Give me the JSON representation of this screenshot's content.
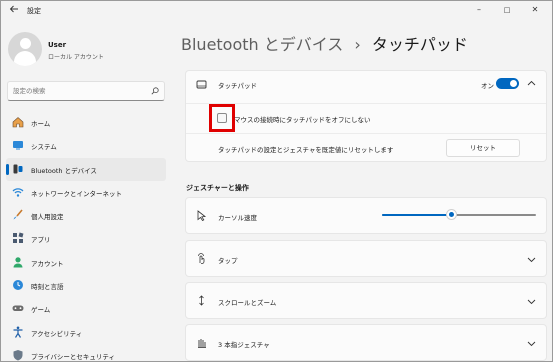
{
  "titlebar": {
    "title": "設定",
    "back_icon": "back-arrow-icon",
    "minimize": "–",
    "maximize": "□",
    "close": "✕"
  },
  "profile": {
    "name": "User",
    "account_type": "ローカル アカウント"
  },
  "search": {
    "placeholder": "設定の検索"
  },
  "sidebar": {
    "items": [
      {
        "label": "ホーム",
        "icon": "home-icon",
        "active": false
      },
      {
        "label": "システム",
        "icon": "system-icon",
        "active": false
      },
      {
        "label": "Bluetooth とデバイス",
        "icon": "bluetooth-icon",
        "active": true
      },
      {
        "label": "ネットワークとインターネット",
        "icon": "wifi-icon",
        "active": false
      },
      {
        "label": "個人用設定",
        "icon": "brush-icon",
        "active": false
      },
      {
        "label": "アプリ",
        "icon": "apps-icon",
        "active": false
      },
      {
        "label": "アカウント",
        "icon": "account-icon",
        "active": false
      },
      {
        "label": "時刻と言語",
        "icon": "globe-clock-icon",
        "active": false
      },
      {
        "label": "ゲーム",
        "icon": "gamepad-icon",
        "active": false
      },
      {
        "label": "アクセシビリティ",
        "icon": "accessibility-icon",
        "active": false
      },
      {
        "label": "プライバシーとセキュリティ",
        "icon": "shield-icon",
        "active": false
      }
    ]
  },
  "main": {
    "breadcrumb_parent": "Bluetooth とデバイス",
    "breadcrumb_separator": "›",
    "page_title": "タッチパッド",
    "touchpad": {
      "label": "タッチパッド",
      "toggle_state": "オン",
      "toggle_on": true
    },
    "mouse_option": {
      "label": "マウスの接続時にタッチパッドをオフにしない",
      "checked": false
    },
    "reset_row": {
      "label": "タッチパッドの設定とジェスチャを既定値にリセットします",
      "button": "リセット"
    },
    "gestures_header": "ジェスチャーと操作",
    "cursor_speed": {
      "label": "カーソル速度",
      "value_fraction": 0.45
    },
    "rows": [
      {
        "label": "タップ",
        "icon": "tap-icon"
      },
      {
        "label": "スクロールとズーム",
        "icon": "scroll-icon"
      },
      {
        "label": "3 本指ジェスチャ",
        "icon": "three-finger-icon"
      }
    ]
  },
  "colors": {
    "accent": "#0067c0",
    "highlight": "#e00000",
    "background": "#f3f3f3",
    "card": "#fbfbfb"
  }
}
